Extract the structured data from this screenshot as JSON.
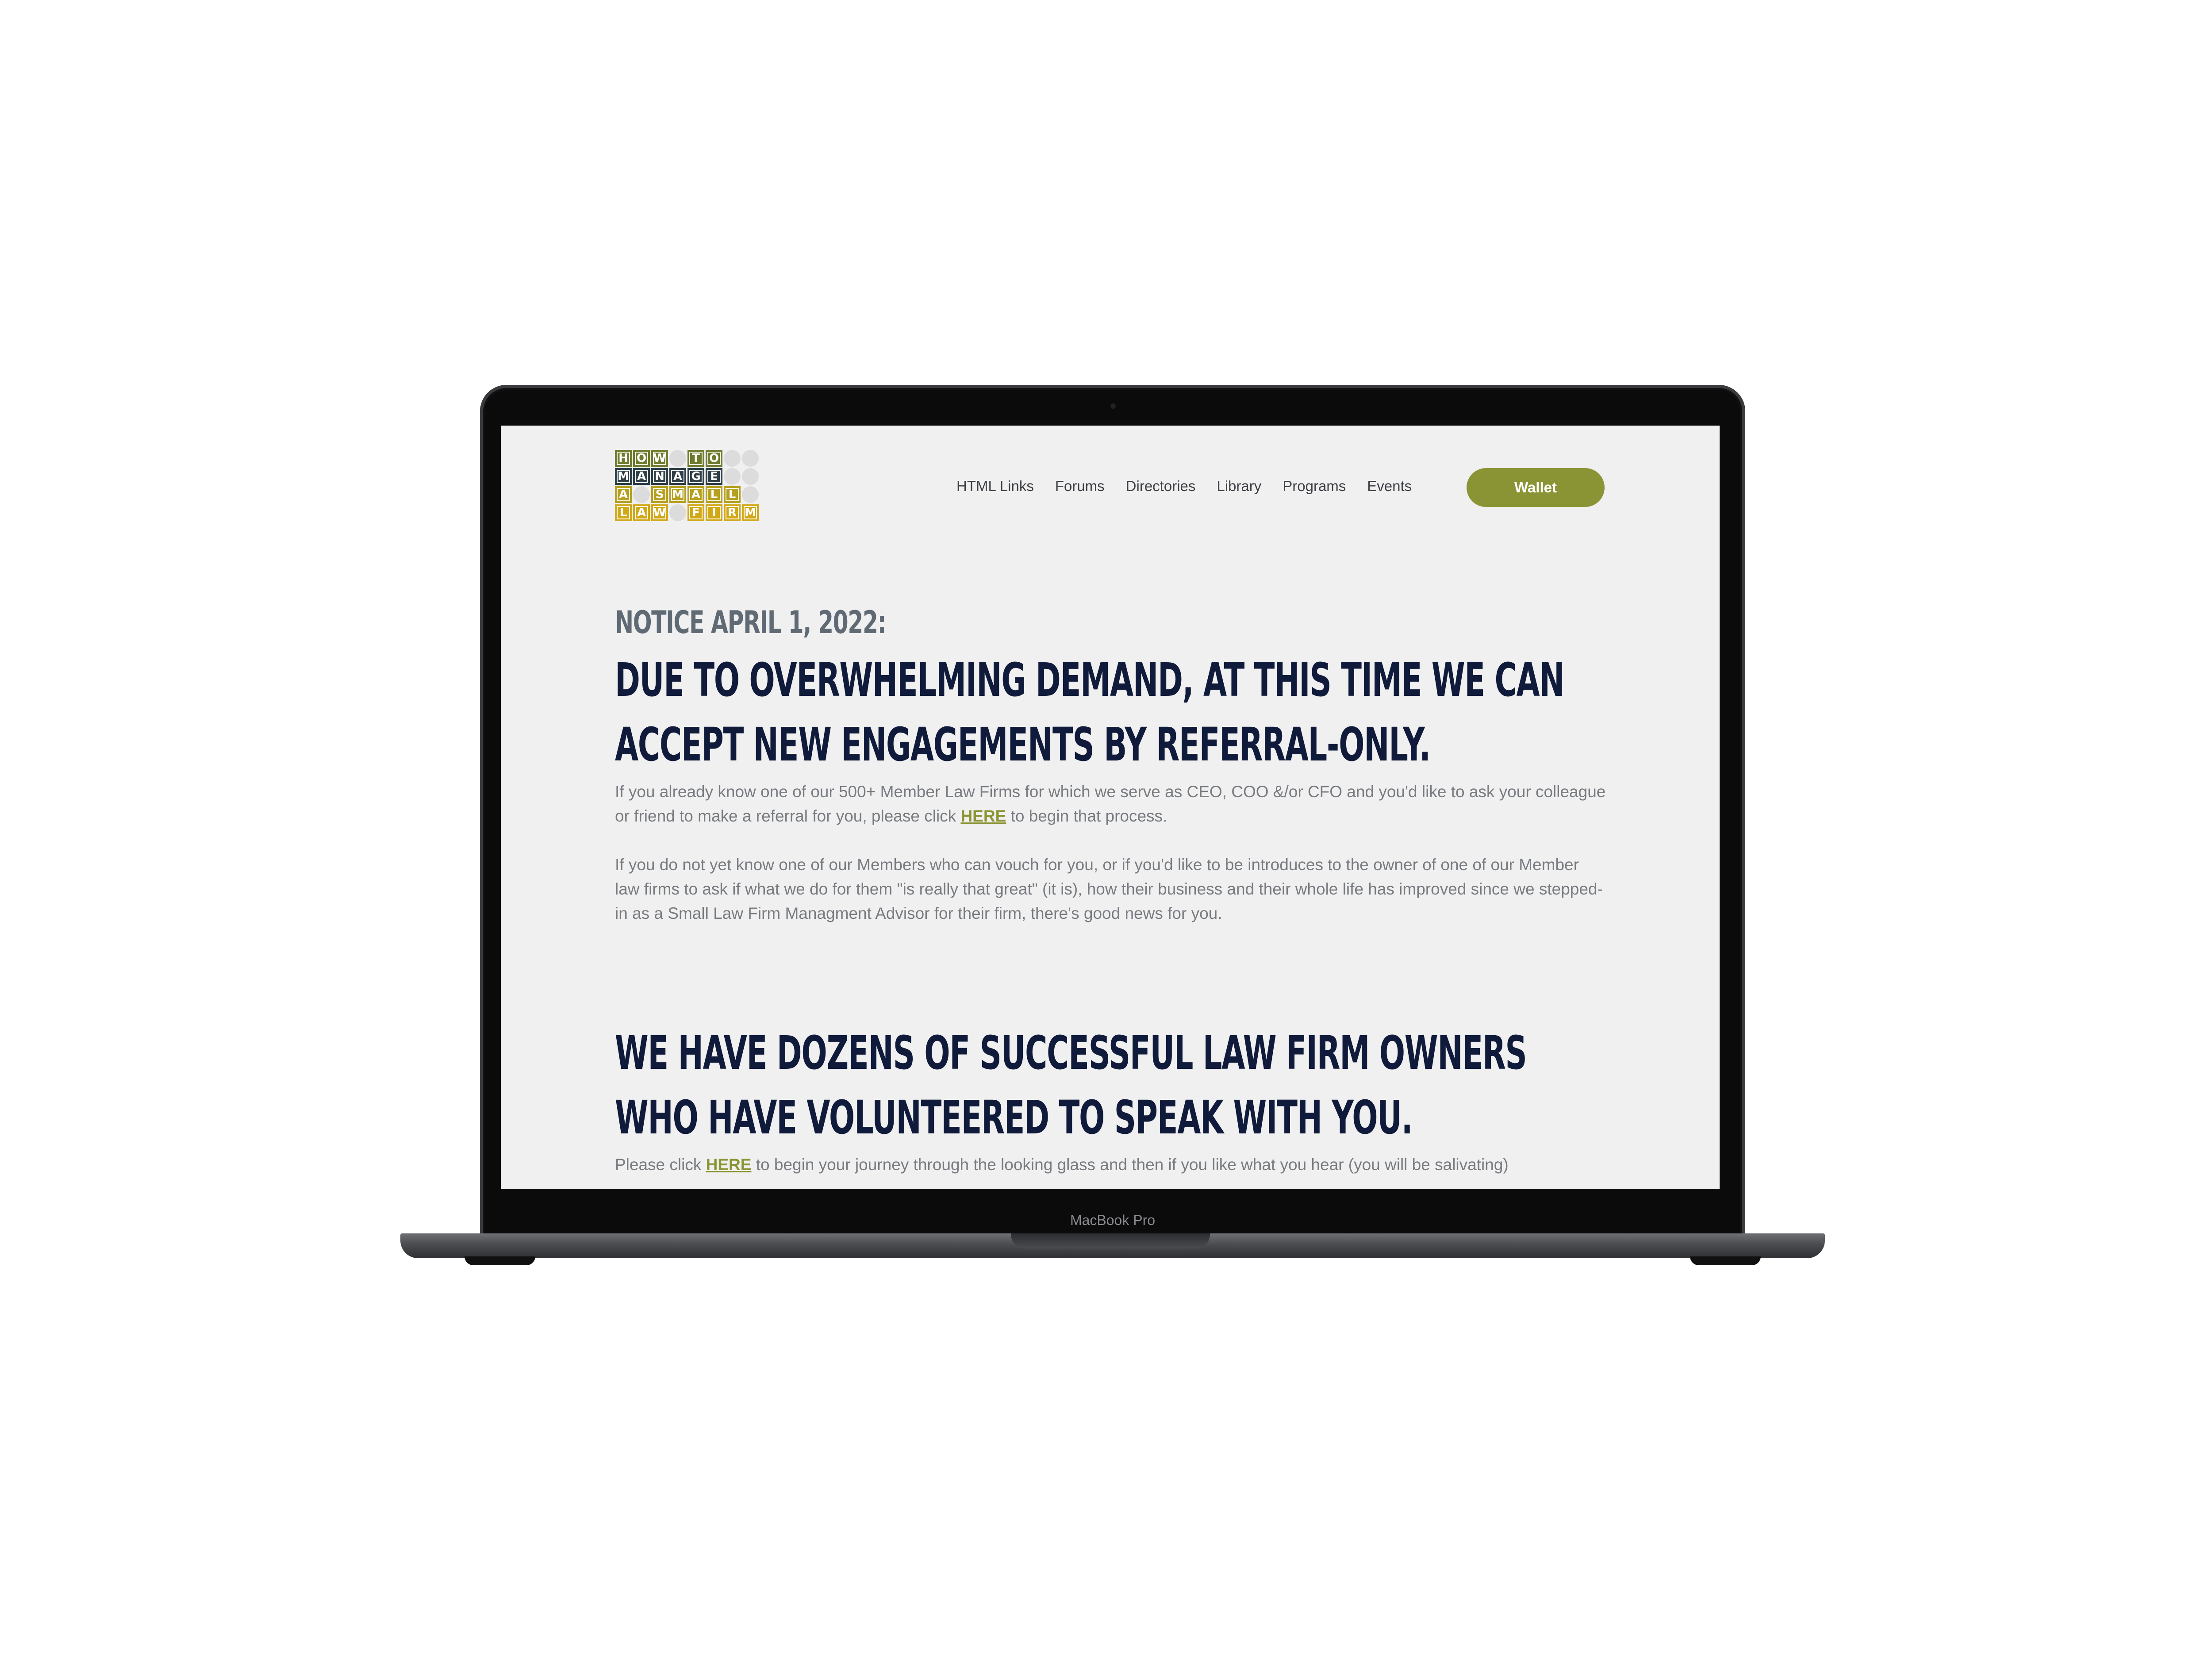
{
  "device": {
    "label": "MacBook Pro"
  },
  "logo": {
    "rows": [
      [
        "H",
        "O",
        "W",
        "",
        "T",
        "O",
        "",
        ""
      ],
      [
        "M",
        "A",
        "N",
        "A",
        "G",
        "E",
        "",
        ""
      ],
      [
        "A",
        "",
        "S",
        "M",
        "A",
        "L",
        "L",
        ""
      ],
      [
        "L",
        "A",
        "W",
        "",
        "F",
        "I",
        "R",
        "M"
      ]
    ]
  },
  "nav": {
    "items": [
      "HTML Links",
      "Forums",
      "Directories",
      "Library",
      "Programs",
      "Events"
    ],
    "wallet_label": "Wallet"
  },
  "main": {
    "notice": "NOTICE APRIL 1, 2022:",
    "headline1_line1": "DUE TO OVERWHELMING DEMAND, AT THIS TIME WE CAN",
    "headline1_line2": "ACCEPT NEW ENGAGEMENTS BY REFERRAL-ONLY.",
    "para1_before": "If you already know one of our 500+ Member Law Firms for which we serve as CEO, COO &/or CFO and you'd like to ask your colleague or friend to make a referral for you, please click ",
    "para1_link": "HERE",
    "para1_after": " to begin that process.",
    "para2": "If you do not yet know one of our Members who can vouch for you, or if you'd like to be introduces to the owner of one of our Member law firms to ask if what we do for them \"is really that great\" (it is), how their business and their whole life has improved since we stepped-in as a Small Law Firm Managment Advisor for their firm, there's good news for you.",
    "headline2_line1": "WE HAVE DOZENS OF SUCCESSFUL LAW FIRM OWNERS",
    "headline2_line2": "WHO HAVE VOLUNTEERED TO SPEAK WITH YOU.",
    "para3_before": "Please click ",
    "para3_link": "HERE",
    "para3_after": " to begin your journey through the looking glass and then if you like what you hear (you will be salivating)"
  },
  "colors": {
    "accent": "#8b9434",
    "headline": "#101b3b",
    "notice": "#5f6a74",
    "body_text": "#777b80",
    "screen_bg": "#f0f0f0"
  }
}
